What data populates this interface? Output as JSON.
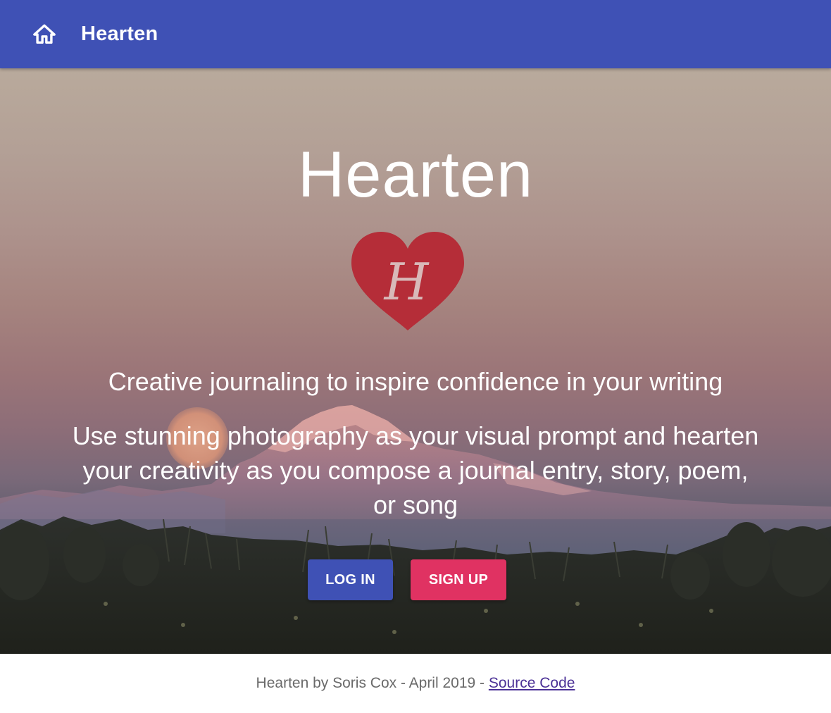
{
  "header": {
    "title": "Hearten",
    "home_icon": "home-icon",
    "background_color": "#3f51b5"
  },
  "hero": {
    "title": "Hearten",
    "logo_letter": "H",
    "logo_color": "#b52d38",
    "tagline": "Creative journaling to inspire confidence in your writing",
    "description": "Use stunning photography as your visual prompt and hearten your creativity as you compose a journal entry, story, poem, or song",
    "login_label": "LOG IN",
    "signup_label": "SIGN UP",
    "login_color": "#3f51b5",
    "signup_color": "#e03262"
  },
  "footer": {
    "text": "Hearten by Soris Cox - April 2019 - ",
    "link_label": "Source Code"
  }
}
